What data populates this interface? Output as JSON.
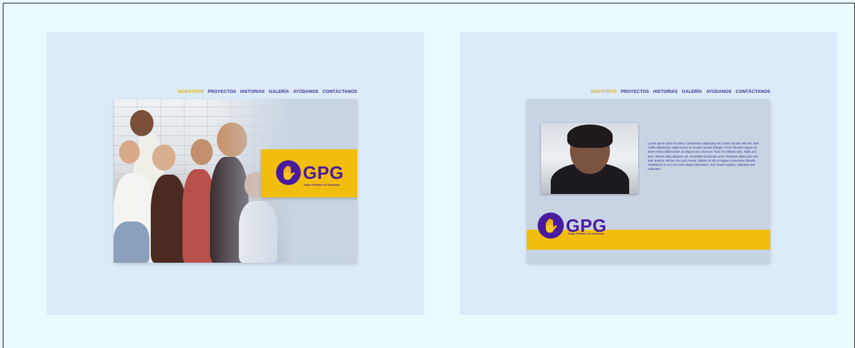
{
  "nav": {
    "items": [
      "NOSOTROS",
      "PROYECTOS",
      "HISTORIAS",
      "GALERÍA",
      "AYÚDANOS",
      "CONTÁCTANOS"
    ],
    "active_index": 0
  },
  "logo": {
    "text": "GPG",
    "subtitle": "Grupo Pediátrico de Guatemala"
  },
  "left_mockup": {
    "photo_alt": "children-group-photo"
  },
  "right_mockup": {
    "photo_alt": "girl-portrait-photo",
    "body_text": "Lorem ipsum dolor sit amet, consectetur adipiscing elit. Donec lacinia velit nec nibh mollis adipiscing. Nulla cursus mi id diam iaculis tristique. Proin lobortis magna sit amet metus ullamcorper ac aliquet arcu rhoncus. Nunc in volutpat odio. Nulla orci sem, laoreet vitae aliquam vel, venenatis accumsan urna. Praesent vitae justo sed ante pretium ultrices nec quis metus. Nullam et elit ut magna consectetur blandit. Vestibulum et orci nec risus aliquet bibendum. Sed mauris sapien, vulputate sed vulputate..."
  },
  "colors": {
    "accent_yellow": "#f2be0e",
    "brand_purple": "#4a1aa0",
    "nav_text": "#3a2890",
    "nav_active": "#d9ae1a"
  }
}
